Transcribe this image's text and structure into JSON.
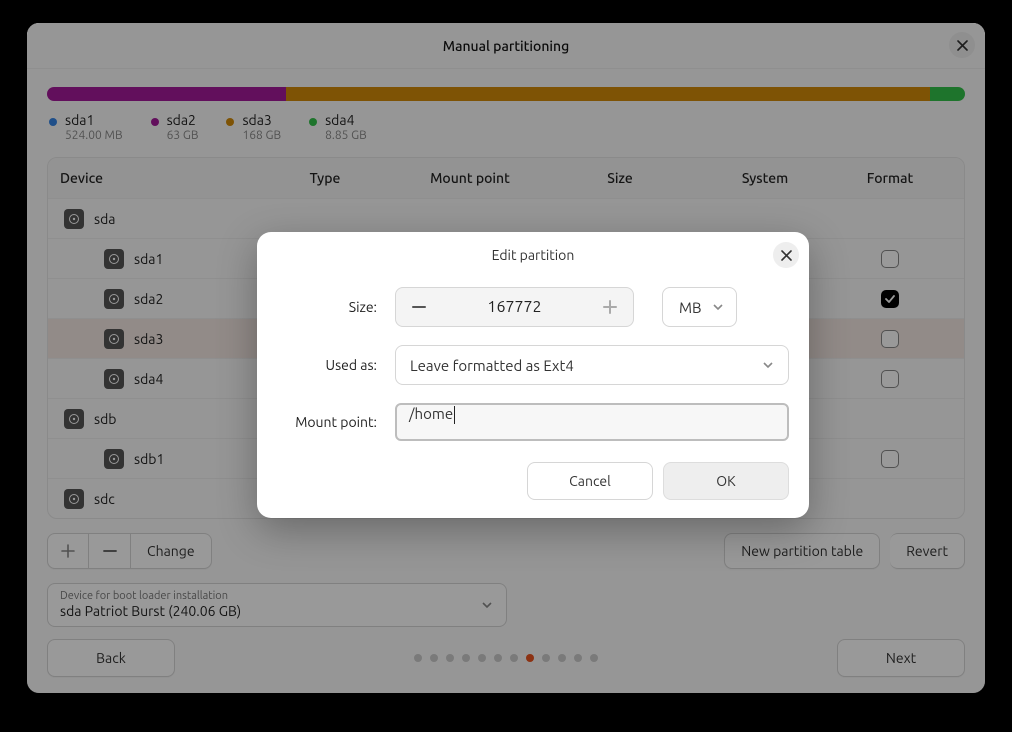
{
  "window_title": "Manual partitioning",
  "colors": {
    "sda1": "#3584e4",
    "sda2": "#a4199a",
    "sda3": "#d38b09",
    "sda4": "#33c24a"
  },
  "bar_segments": [
    {
      "key": "sda2",
      "width": "26.0%"
    },
    {
      "key": "sda3",
      "width": "70.2%"
    },
    {
      "key": "sda4",
      "width": "3.8%"
    }
  ],
  "legend": [
    {
      "key": "sda1",
      "name": "sda1",
      "size": "524.00 MB"
    },
    {
      "key": "sda2",
      "name": "sda2",
      "size": "63 GB"
    },
    {
      "key": "sda3",
      "name": "sda3",
      "size": "168 GB"
    },
    {
      "key": "sda4",
      "name": "sda4",
      "size": "8.85 GB"
    }
  ],
  "columns": {
    "device": "Device",
    "type": "Type",
    "mount": "Mount point",
    "size": "Size",
    "system": "System",
    "format": "Format"
  },
  "rows": [
    {
      "indent": 0,
      "name": "sda"
    },
    {
      "indent": 1,
      "name": "sda1",
      "format": false
    },
    {
      "indent": 1,
      "name": "sda2",
      "format": true
    },
    {
      "indent": 1,
      "name": "sda3",
      "format": false,
      "selected": true
    },
    {
      "indent": 1,
      "name": "sda4",
      "format": false
    },
    {
      "indent": 0,
      "name": "sdb"
    },
    {
      "indent": 1,
      "name": "sdb1",
      "format": false
    },
    {
      "indent": 0,
      "name": "sdc"
    }
  ],
  "toolbar": {
    "change": "Change",
    "new_table": "New partition table",
    "revert": "Revert"
  },
  "boot": {
    "label": "Device for boot loader installation",
    "value": "sda Patriot Burst (240.06 GB)"
  },
  "footer": {
    "back": "Back",
    "next": "Next",
    "total_dots": 12,
    "active_dot": 7
  },
  "modal": {
    "title": "Edit partition",
    "label_size": "Size:",
    "label_used": "Used as:",
    "label_mount": "Mount point:",
    "size_value": "167772",
    "size_unit": "MB",
    "used_as": "Leave formatted as Ext4",
    "mount_value": "/home",
    "cancel": "Cancel",
    "ok": "OK"
  }
}
